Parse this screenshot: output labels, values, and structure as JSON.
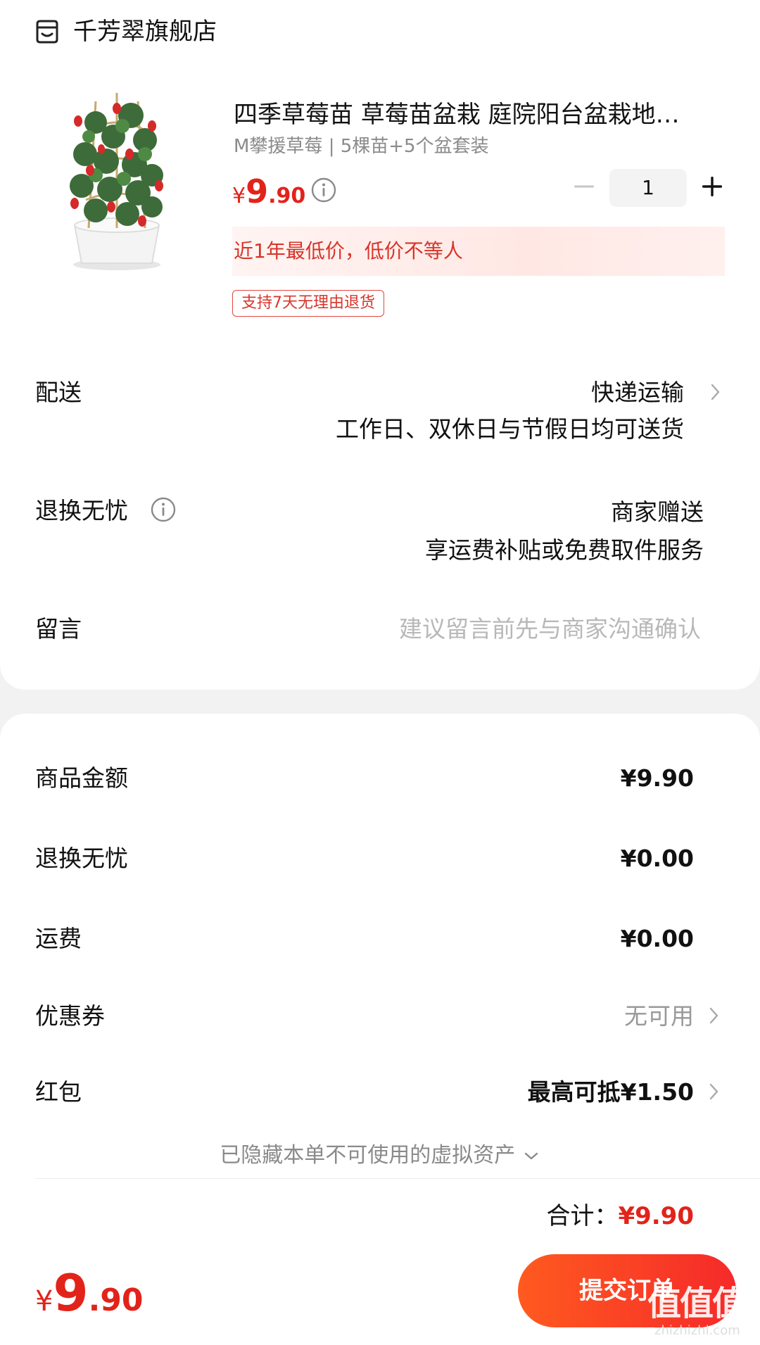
{
  "store": {
    "icon": "store-icon",
    "name": "千芳翠旗舰店"
  },
  "product": {
    "title": "四季草莓苗 草莓苗盆栽 庭院阳台盆栽地…",
    "spec": "M攀援草莓 | 5棵苗+5个盆套装",
    "price": {
      "symbol": "¥",
      "integer": "9",
      "decimal": ".90"
    },
    "quantity": "1",
    "lowest_price_note": "近1年最低价，低价不等人",
    "return_tag": "支持7天无理由退货"
  },
  "delivery": {
    "label": "配送",
    "value": "快递运输",
    "note": "工作日、双休日与节假日均可送货"
  },
  "return_worry_free": {
    "label": "退换无忧",
    "value": "商家赠送",
    "note": "享运费补贴或免费取件服务"
  },
  "message": {
    "label": "留言",
    "placeholder": "建议留言前先与商家沟通确认"
  },
  "summary": {
    "goods_amount": {
      "label": "商品金额",
      "value": "¥9.90"
    },
    "return_worry_free": {
      "label": "退换无忧",
      "value": "¥0.00"
    },
    "shipping": {
      "label": "运费",
      "value": "¥0.00"
    },
    "coupon": {
      "label": "优惠券",
      "value": "无可用"
    },
    "red_packet": {
      "label": "红包",
      "value": "最高可抵¥1.50"
    },
    "hidden_assets": "已隐藏本单不可使用的虚拟资产",
    "total_label": "合计：",
    "total_value": "¥9.90"
  },
  "bottom_bar": {
    "price": {
      "symbol": "¥",
      "integer": "9",
      "decimal": ".90"
    },
    "submit_label": "提交订单"
  },
  "watermark": {
    "text": "值值值",
    "url": "zhizhizhi.com"
  },
  "colors": {
    "accent": "#e2231a",
    "button_start": "#ff5a1f",
    "button_end": "#f52a2a"
  }
}
